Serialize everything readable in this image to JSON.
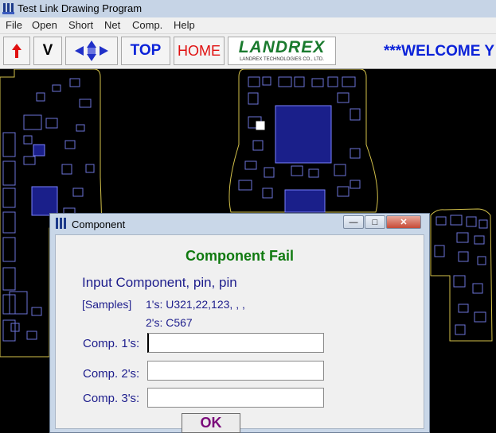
{
  "window": {
    "title": "Test Link Drawing Program"
  },
  "menu": [
    "File",
    "Open",
    "Short",
    "Net",
    "Comp.",
    "Help"
  ],
  "toolbar": {
    "v_label": "V",
    "top_label": "TOP",
    "home_label": "HOME",
    "logo_text": "LANDREX",
    "logo_subtext": "LANDREX TECHNOLOGIES CO., LTD.",
    "welcome": "***WELCOME Y"
  },
  "dialog": {
    "title": "Component",
    "heading": "Component Fail",
    "instruction": "Input Component, pin, pin",
    "samples_label": "[Samples]",
    "sample1": "1's: U321,22,123, , ,",
    "sample2": "2's: C567",
    "field1_label": "Comp. 1's:",
    "field2_label": "Comp. 2's:",
    "field3_label": "Comp. 3's:",
    "field1_value": "",
    "field2_value": "",
    "field3_value": "",
    "ok_label": "OK"
  },
  "colors": {
    "accent_blue": "#0b22d9",
    "home_red": "#e01010",
    "heading_green": "#107a10",
    "text_navy": "#1d1d8c",
    "ok_purple": "#7a0a7a",
    "board_outline": "#d4c24a",
    "component_blue": "#6c74d8"
  }
}
